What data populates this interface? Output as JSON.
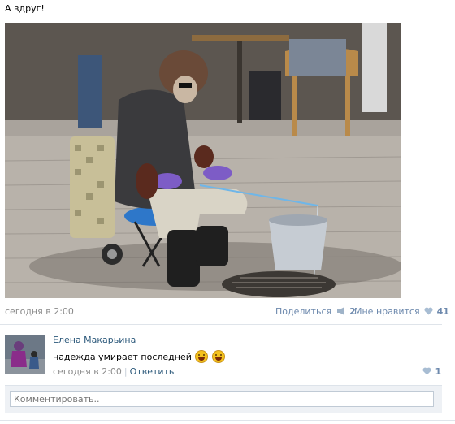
{
  "post": {
    "text": "А вдруг!",
    "date": "сегодня в 2:00",
    "share_label": "Поделиться",
    "share_count": "2",
    "like_label": "Мне нравится",
    "like_count": "41"
  },
  "comment": {
    "author": "Елена Макарьина",
    "text": "надежда умирает последней",
    "emojis": [
      "grinning-emoji",
      "laughing-emoji"
    ],
    "date": "сегодня в 2:00",
    "separator": "|",
    "reply_label": "Ответить",
    "like_count": "1"
  },
  "reply": {
    "placeholder": "Комментировать.."
  },
  "icons": {
    "share": "megaphone-icon",
    "like": "heart-icon"
  },
  "colors": {
    "link": "#2b587a",
    "muted_link": "#6d89ad",
    "meta": "#8a8a8a"
  }
}
